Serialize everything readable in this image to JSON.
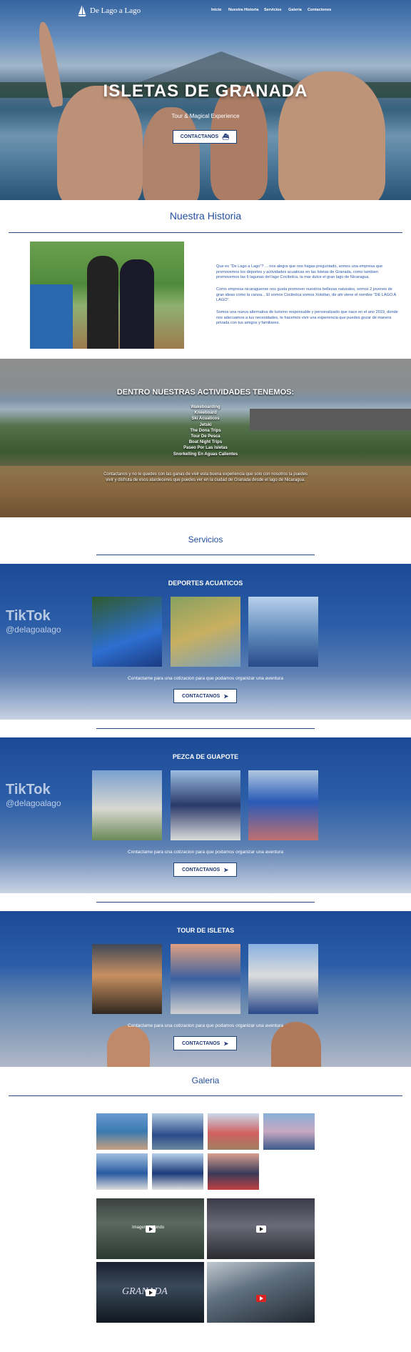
{
  "brand": {
    "name": "De Lago a Lago"
  },
  "nav": {
    "items": [
      "Inicio",
      "Nuestra Historia",
      "Servicios",
      "Galeria",
      "Contactenos"
    ]
  },
  "hero": {
    "title": "ISLETAS DE GRANADA",
    "subtitle": "Tour & Magical Experience",
    "cta": "CONTACTANOS",
    "cta_icon": "boat-icon"
  },
  "historia": {
    "title": "Nuestra Historia",
    "paragraphs": [
      "Que es \"De Lago a Lago\"? ... nos alegra que nos hagas preguntado, somos una empresa que promovemos los deportes y actividades acuaticas en las Isletas de Granada, como tambien promovemos las 6 lagunas del lago Cocibolca, la mar dulce el gran lago de Nicaragua.",
      "Como empresa nicaraguense nos gusta promover nuestros bellezas naturales, somos 2 jovenes de gran ideas como la canoa... El somos Cocibolca somos Xolotlan, de ahi viene el nombre \"DE LAGO A LAGO\".",
      "Somos una nueva alternativa de turismo responsable y personalizado que nace en el ano 2019, donde nos adecuamos a tus necesidades, te hacemos vivir una experiencia que puedes gozar de manera privada con tus amigos y familiares."
    ]
  },
  "actividades": {
    "title": "DENTRO NUESTRAS ACTIVIDADES TENEMOS:",
    "items": [
      "Wakeboarding",
      "Kneeboard",
      "Ski Acuaticos",
      "Jetski",
      "The Dona Trips",
      "Tour De Pesca",
      "Boat Night Trips",
      "Paseo Por Las Isletas",
      "Snorkelling En Aguas Calientes"
    ],
    "footer": "Contactanos y no te quedes con las ganas de vivir esta buena experiencia que solo con nosotros la puedes vivir y disfruta de esos atardeceres que puedes ver en la ciudad de Granada desde el lago de Nicaragua."
  },
  "servicios": {
    "title": "Servicios",
    "tiktok_label": "TikTok",
    "tiktok_handle": "@delagoalago",
    "blocks": [
      {
        "title": "DEPORTES ACUATICOS",
        "note": "Contactame para una cotizacion para que podamos organizar una aventura",
        "cta": "CONTACTANOS"
      },
      {
        "title": "PEZCA DE GUAPOTE",
        "note": "Contactame para una cotizacion para que podamos organizar una aventura",
        "cta": "CONTACTANOS"
      },
      {
        "title": "TOUR DE ISLETAS",
        "note": "Contactame para una cotizacion para que podamos organizar una aventura",
        "cta": "CONTACTANOS"
      }
    ]
  },
  "galeria": {
    "title": "Galeria",
    "video_text_1": "Imagen de fondo",
    "video_text_2": "GRANADA"
  },
  "colors": {
    "accent": "#234f9e",
    "rule": "#2a4a86",
    "button_text": "#1e3a78"
  }
}
